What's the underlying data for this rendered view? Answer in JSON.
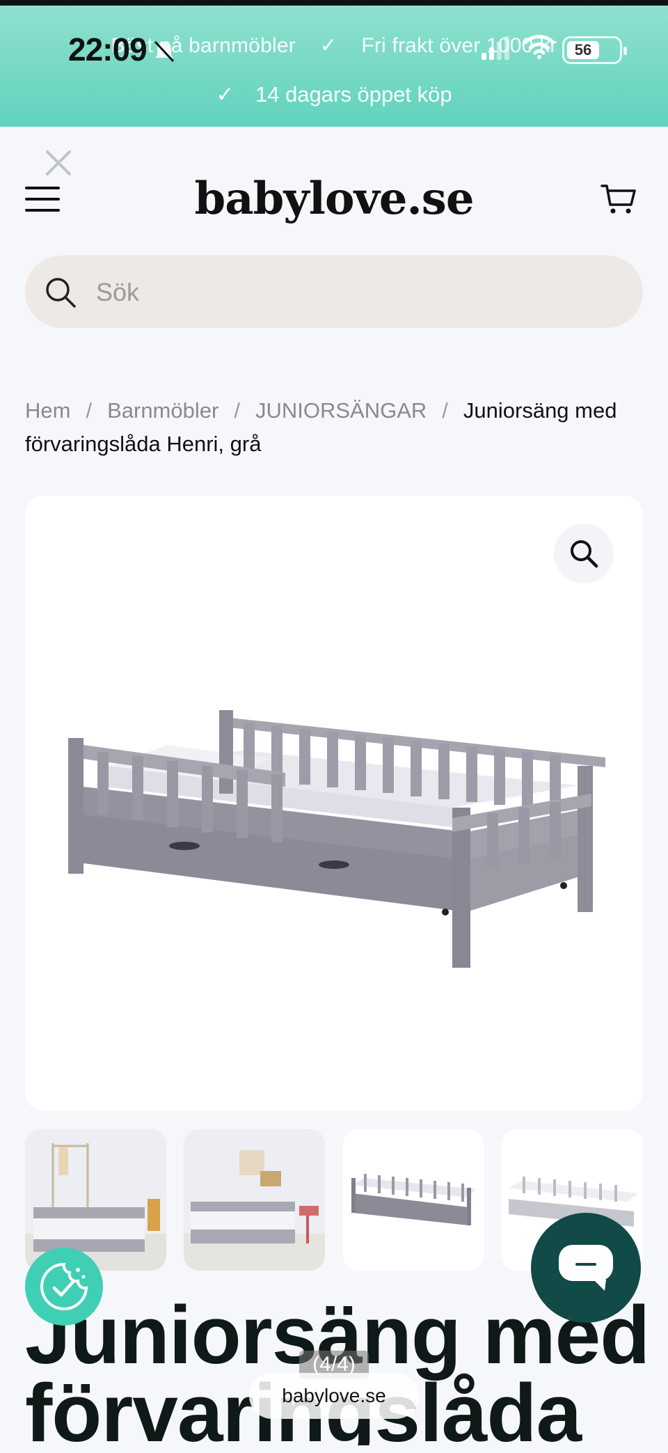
{
  "status_bar": {
    "time": "22:09",
    "battery": "56"
  },
  "announcement": {
    "item1": "Bäst på barnmöbler",
    "item2": "Fri frakt över 1000 kr",
    "item3": "14 dagars öppet köp",
    "check_icon": "✓"
  },
  "header": {
    "logo": "babylove.se"
  },
  "search": {
    "placeholder": "Sök"
  },
  "breadcrumb": {
    "items": [
      "Hem",
      "Barnmöbler",
      "JUNIORSÄNGAR"
    ],
    "separator": "/",
    "current": "Juniorsäng med förvaringslåda Henri, grå"
  },
  "gallery": {
    "pager": "(4/4)"
  },
  "product": {
    "title_line1": "Juniorsäng med",
    "title_line2": "förvaringslåda"
  },
  "browser": {
    "url": "babylove.se"
  },
  "colors": {
    "accent": "#61d3bd",
    "chat": "#114a47",
    "bed": "#8e8e98"
  }
}
